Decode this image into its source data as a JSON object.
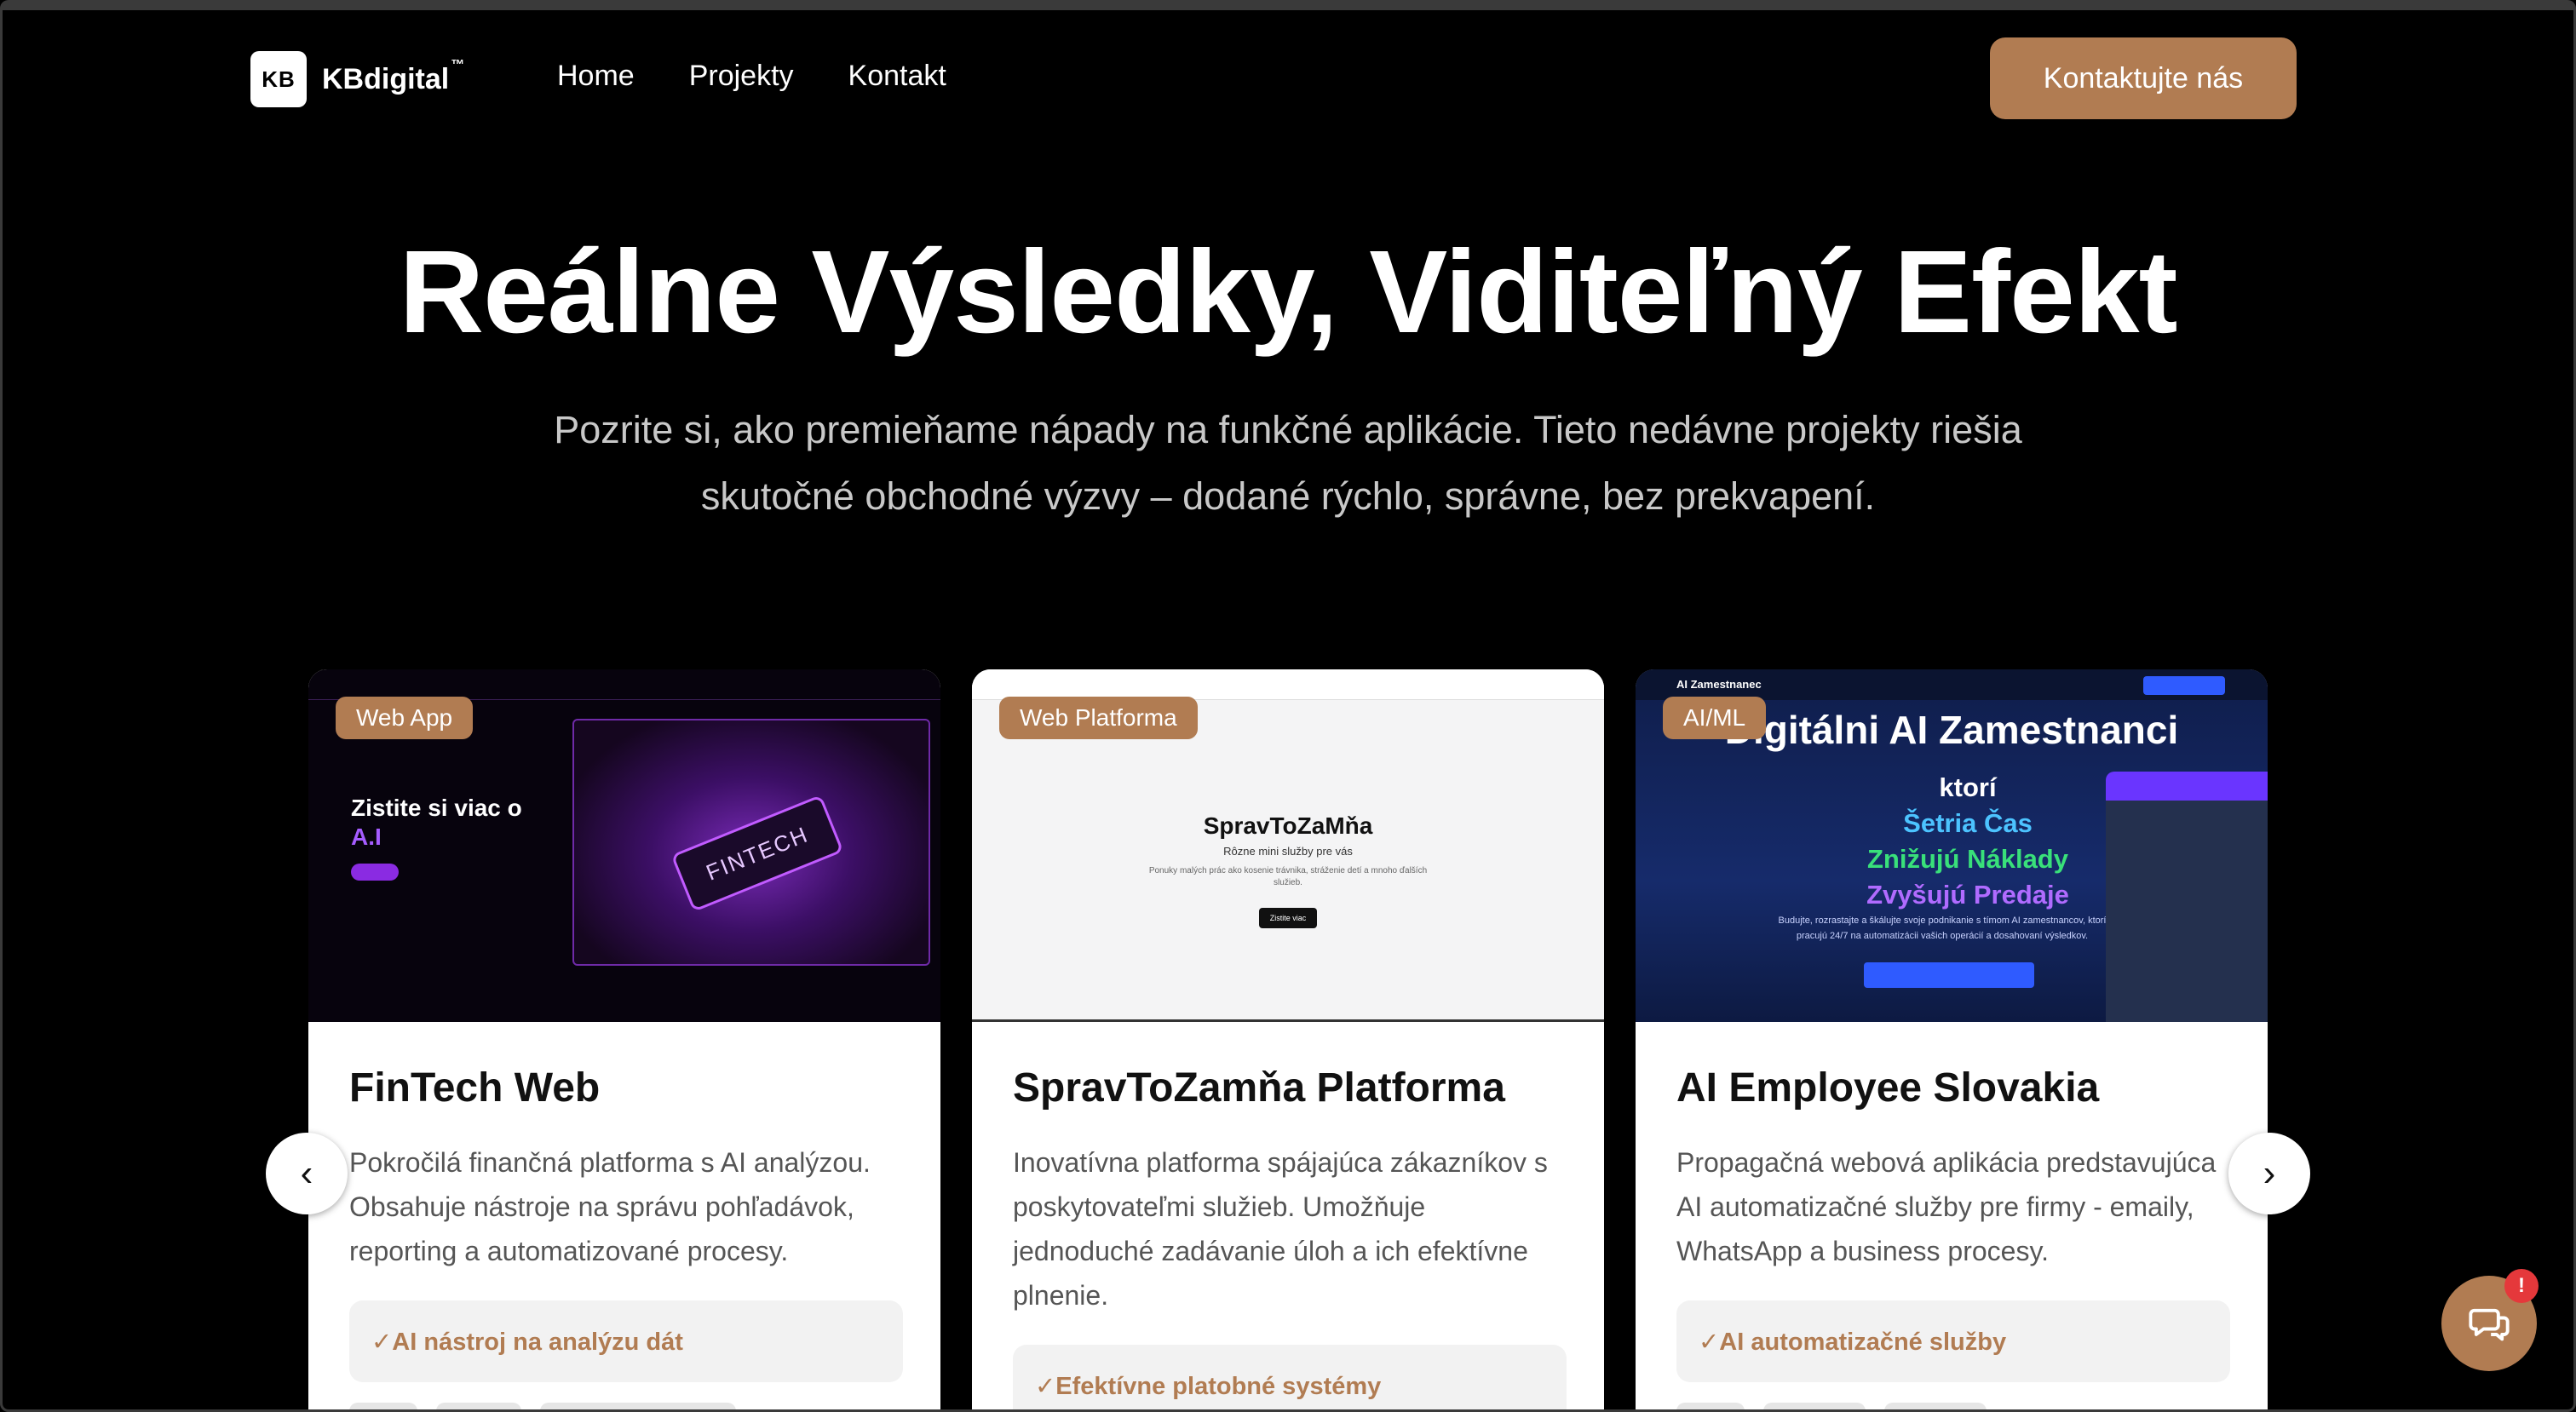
{
  "brand": {
    "logo_mark": "KB",
    "name": "KBdigital",
    "trademark": "™"
  },
  "nav": {
    "links": [
      "Home",
      "Projekty",
      "Kontakt"
    ],
    "cta": "Kontaktujte nás"
  },
  "hero": {
    "title": "Reálne Výsledky, Viditeľný Efekt",
    "subtitle": "Pozrite si, ako premieňame nápady na funkčné aplikácie. Tieto nedávne projekty riešia skutočné obchodné výzvy – dodané rýchlo, správne, bez prekvapení."
  },
  "projects": [
    {
      "badge": "Web App",
      "title": "FinTech Web",
      "description": "Pokročilá finančná platforma s AI analýzou. Obsahuje nástroje na správu pohľadávok, reporting a automatizované procesy.",
      "feature": "✓AI nástroj na analýzu dát",
      "preview": {
        "heading_a": "Zistite si viac o",
        "heading_b": "A.I",
        "phone_text": "FINTECH"
      }
    },
    {
      "badge": "Web Platforma",
      "title": "SpravToZamňa Platforma",
      "description": "Inovatívna platforma spájajúca zákazníkov s poskytovateľmi služieb. Umožňuje jednoduché zadávanie úloh a ich efektívne plnenie.",
      "feature": "✓Efektívne platobné systémy",
      "preview": {
        "heading": "SpravToZaMňa",
        "sub": "Rôzne mini služby pre vás",
        "desc": "Ponuky malých prác ako kosenie trávnika, stráženie detí a mnoho ďalších služieb.",
        "button": "Zistite viac"
      }
    },
    {
      "badge": "AI/ML",
      "title": "AI Employee Slovakia",
      "description": "Propagačná webová aplikácia predstavujúca AI automatizačné služby pre firmy - emaily, WhatsApp a business procesy.",
      "feature": "✓AI automatizačné služby",
      "preview": {
        "nav_title": "AI Zamestnanec",
        "big": "Digitálni AI Zamestnanci",
        "line1": "ktorí",
        "line2": "Šetria Čas",
        "line3": "Znižujú Náklady",
        "line4": "Zvyšujú Predaje",
        "small": "Budujte, rozrastajte a škálujte svoje podnikanie s tímom AI zamestnancov, ktorí pracujú 24/7 na automatizácii vašich operácií a dosahovaní výsledkov."
      }
    }
  ],
  "carousel": {
    "prev_icon": "chevron-left-icon",
    "next_icon": "chevron-right-icon",
    "prev_glyph": "‹",
    "next_glyph": "›"
  },
  "chat": {
    "icon": "chat-icon",
    "badge": "!"
  },
  "colors": {
    "accent": "#b17c52",
    "background": "#000000"
  }
}
